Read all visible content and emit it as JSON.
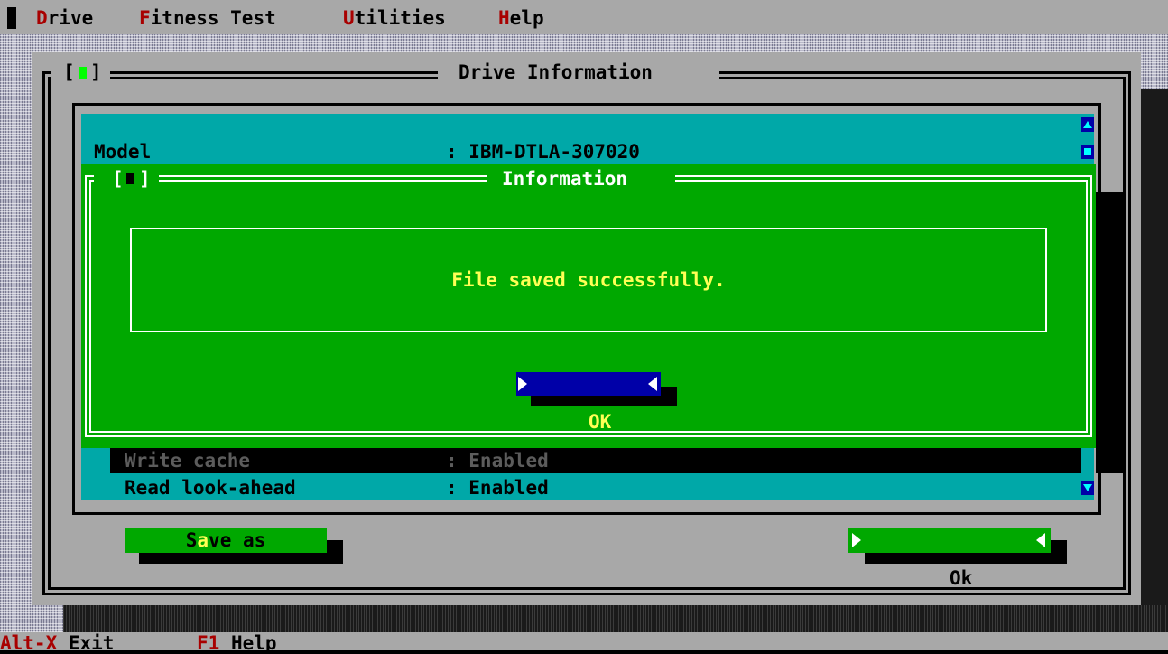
{
  "menu": {
    "items": [
      {
        "hotkey": "D",
        "rest": "rive"
      },
      {
        "hotkey": "F",
        "rest": "itness Test"
      },
      {
        "hotkey": "U",
        "rest": "tilities"
      },
      {
        "hotkey": "H",
        "rest": "elp"
      }
    ]
  },
  "window": {
    "title": "Drive Information",
    "close_left": "[",
    "close_right": "]"
  },
  "drive_info": {
    "rows": [
      {
        "label": "Model",
        "value": ": IBM-DTLA-307020"
      },
      {
        "label": "Write cache",
        "value": ": Enabled"
      },
      {
        "label": "Read look-ahead",
        "value": ": Enabled"
      }
    ]
  },
  "buttons": {
    "save_as_pre": "S",
    "save_as_hotkey": "a",
    "save_as_post": "ve as",
    "ok": "Ok"
  },
  "dialog": {
    "title": "Information",
    "close_left": "[",
    "close_right": "]",
    "message": "File saved successfully.",
    "ok": "OK"
  },
  "status": {
    "items": [
      {
        "key": "Alt-X",
        "label": "Exit"
      },
      {
        "key": "F1",
        "label": "Help"
      }
    ]
  },
  "colors": {
    "window_gray": "#a8a8a8",
    "list_cyan": "#00a8a8",
    "dialog_green": "#00a800",
    "button_blue": "#0000a8",
    "hotkey_red": "#a80000",
    "message_yellow": "#ffff55"
  }
}
